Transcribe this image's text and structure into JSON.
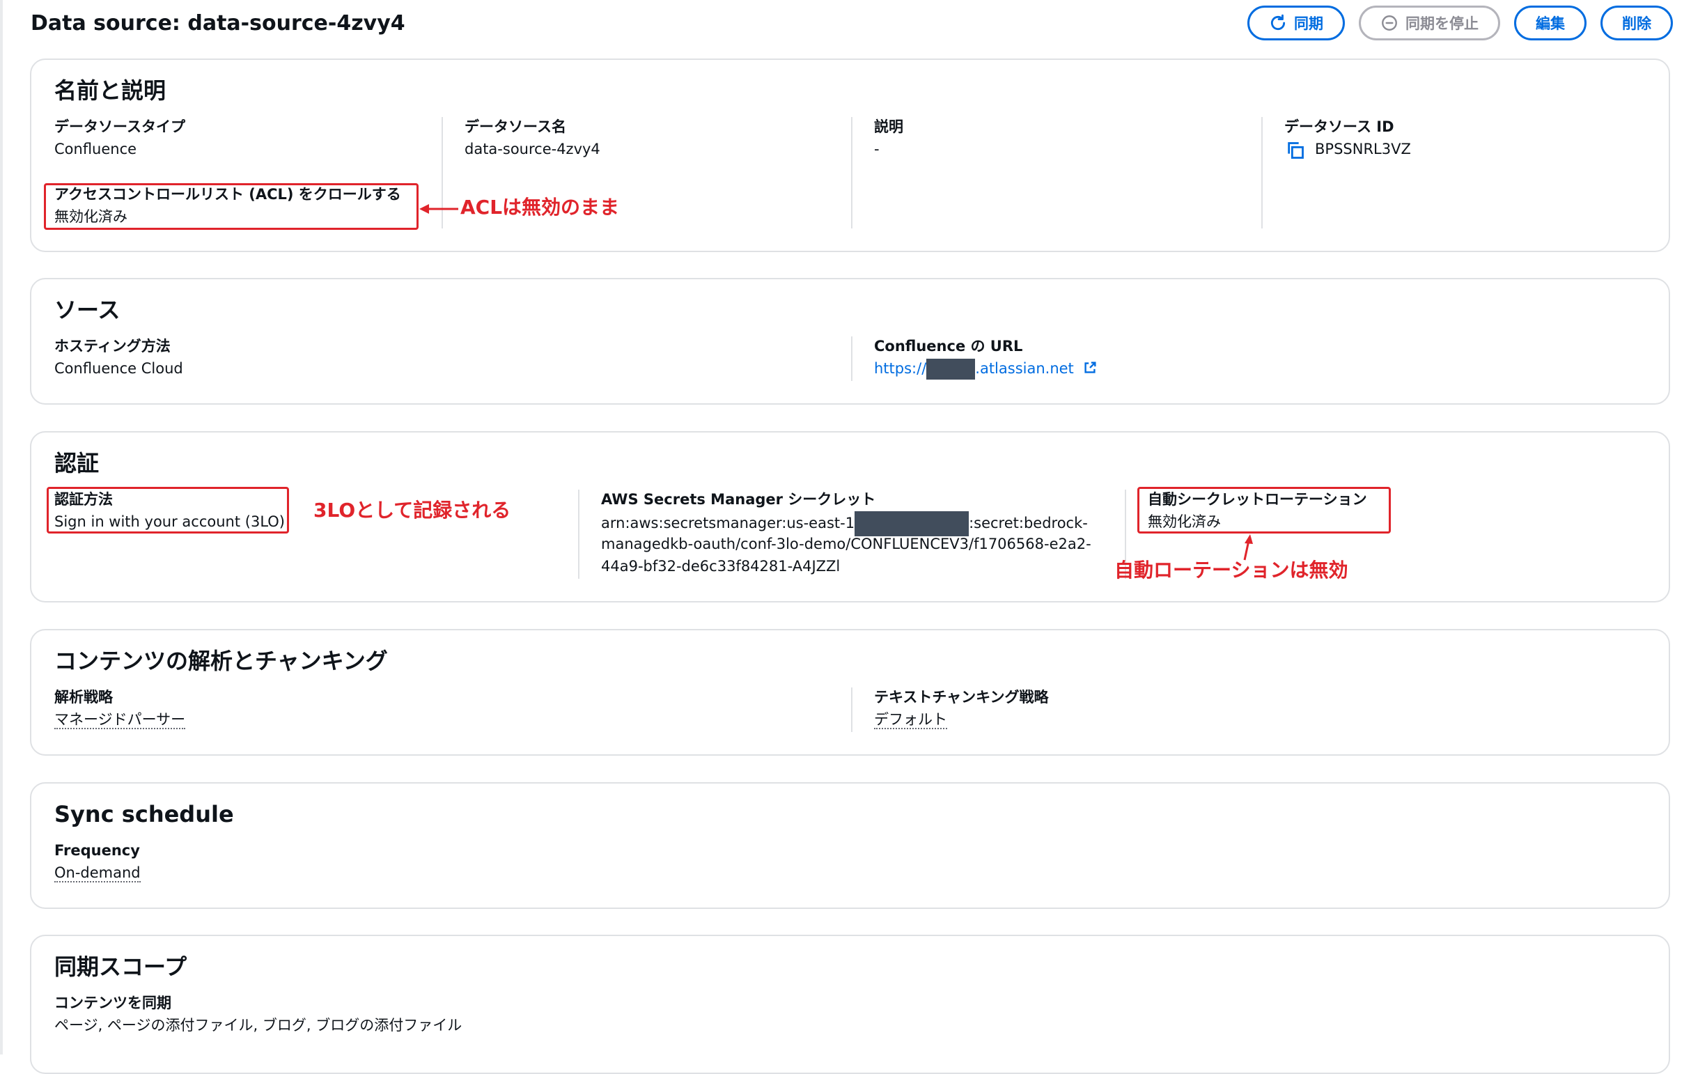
{
  "header": {
    "title": "Data source: data-source-4zvy4",
    "buttons": {
      "sync": "同期",
      "stop_sync": "同期を停止",
      "edit": "編集",
      "delete": "削除"
    }
  },
  "name_section": {
    "title": "名前と説明",
    "type_label": "データソースタイプ",
    "type_value": "Confluence",
    "name_label": "データソース名",
    "name_value": "data-source-4zvy4",
    "desc_label": "説明",
    "desc_value": "-",
    "id_label": "データソース ID",
    "id_value": "BPSSNRL3VZ",
    "acl_label": "アクセスコントロールリスト (ACL) をクロールする",
    "acl_value": "無効化済み"
  },
  "source_section": {
    "title": "ソース",
    "hosting_label": "ホスティング方法",
    "hosting_value": "Confluence Cloud",
    "url_label": "Confluence の URL",
    "url_prefix": "https://",
    "url_suffix": ".atlassian.net"
  },
  "auth_section": {
    "title": "認証",
    "method_label": "認証方法",
    "method_value": "Sign in with your account (3LO)",
    "secret_label": "AWS Secrets Manager シークレット",
    "secret_line1_prefix": "arn:aws:secretsmanager:us-east-1",
    "secret_line1_suffix": ":secret:bedrock-",
    "secret_line2": "managedkb-oauth/conf-3lo-demo/CONFLUENCEV3/f1706568-e2a2-",
    "secret_line3": "44a9-bf32-de6c33f84281-A4JZZl",
    "rotation_label": "自動シークレットローテーション",
    "rotation_value": "無効化済み"
  },
  "parsing_section": {
    "title": "コンテンツの解析とチャンキング",
    "parse_label": "解析戦略",
    "parse_value": "マネージドパーサー",
    "chunk_label": "テキストチャンキング戦略",
    "chunk_value": "デフォルト"
  },
  "sync_schedule": {
    "title": "Sync schedule",
    "freq_label": "Frequency",
    "freq_value": "On-demand"
  },
  "sync_scope": {
    "title": "同期スコープ",
    "content_label": "コンテンツを同期",
    "content_value": "ページ, ページの添付ファイル, ブログ, ブログの添付ファイル"
  },
  "annotations": {
    "acl": "ACLは無効のまま",
    "threelo": "3LOとして記録される",
    "rotation": "自動ローテーションは無効"
  },
  "colors": {
    "accent": "#006ce0",
    "annotation": "#e0242b",
    "redaction": "#414d5c"
  }
}
